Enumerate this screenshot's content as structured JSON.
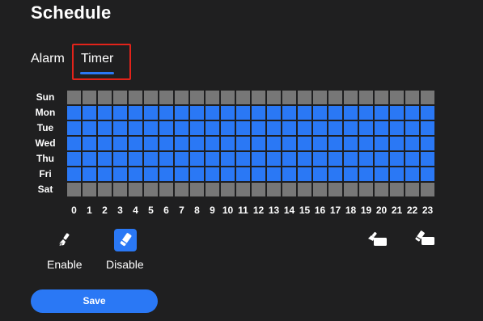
{
  "page": {
    "title": "Schedule"
  },
  "tabs": {
    "alarm": "Alarm",
    "timer": "Timer",
    "active": "Timer"
  },
  "schedule": {
    "days": [
      "Sun",
      "Mon",
      "Tue",
      "Wed",
      "Thu",
      "Fri",
      "Sat"
    ],
    "hours": [
      "0",
      "1",
      "2",
      "3",
      "4",
      "5",
      "6",
      "7",
      "8",
      "9",
      "10",
      "11",
      "12",
      "13",
      "14",
      "15",
      "16",
      "17",
      "18",
      "19",
      "20",
      "21",
      "22",
      "23"
    ],
    "enabled_days": [
      false,
      true,
      true,
      true,
      true,
      true,
      false
    ]
  },
  "tools": {
    "enable_label": "Enable",
    "disable_label": "Disable",
    "selected": "Disable",
    "enable_icon": "brush-icon",
    "disable_icon": "eraser-icon",
    "enable_all_icon": "brush-fill-all-icon",
    "disable_all_icon": "eraser-clear-all-icon"
  },
  "save": {
    "label": "Save"
  },
  "colors": {
    "background": "#1f1f20",
    "accent": "#2a78f5",
    "cell_off": "#777777",
    "highlight": "#e2231a"
  }
}
